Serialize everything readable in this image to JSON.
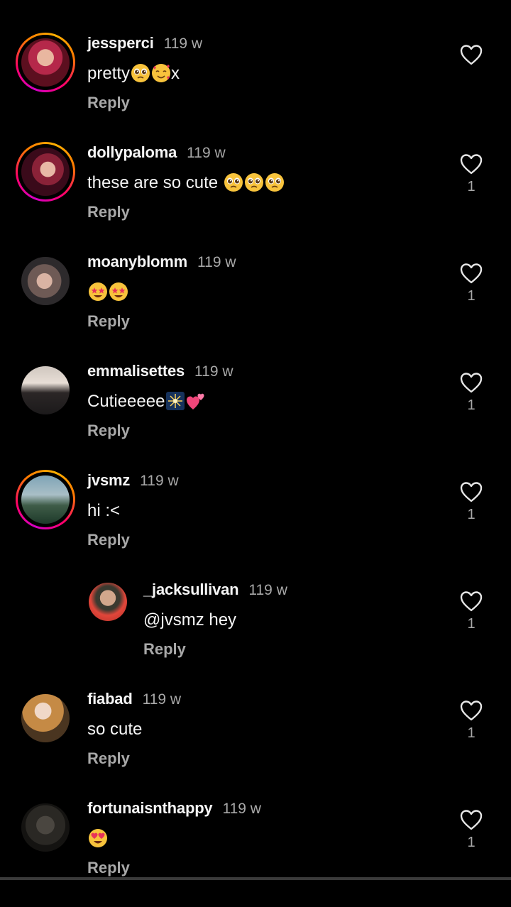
{
  "comments": [
    {
      "username": "jessperci",
      "time": "119 w",
      "text": "pretty",
      "text_suffix": "x",
      "emojis": [
        "pleading-face-emoji",
        "smiling-face-with-hearts-emoji"
      ],
      "reply_label": "Reply",
      "likes": "",
      "has_story_ring": true
    },
    {
      "username": "dollypaloma",
      "time": "119 w",
      "text": "these are so cute ",
      "emojis": [
        "pleading-face-emoji",
        "pleading-face-emoji",
        "pleading-face-emoji"
      ],
      "reply_label": "Reply",
      "likes": "1",
      "has_story_ring": true
    },
    {
      "username": "moanyblomm",
      "time": "119 w",
      "text": "",
      "emojis": [
        "star-struck-emoji",
        "star-struck-emoji"
      ],
      "reply_label": "Reply",
      "likes": "1",
      "has_story_ring": false
    },
    {
      "username": "emmalisettes",
      "time": "119 w",
      "text": "Cutieeeee",
      "emojis": [
        "sparkler-emoji",
        "two-hearts-emoji"
      ],
      "reply_label": "Reply",
      "likes": "1",
      "has_story_ring": false
    },
    {
      "username": "jvsmz",
      "time": "119 w",
      "text": "hi :<",
      "emojis": [],
      "reply_label": "Reply",
      "likes": "1",
      "has_story_ring": true
    },
    {
      "username": "_jacksullivan",
      "time": "119 w",
      "text": "@jvsmz hey",
      "emojis": [],
      "reply_label": "Reply",
      "likes": "1",
      "has_story_ring": false,
      "is_reply": true
    },
    {
      "username": "fiabad",
      "time": "119 w",
      "text": "so cute",
      "emojis": [],
      "reply_label": "Reply",
      "likes": "1",
      "has_story_ring": false
    },
    {
      "username": "fortunaisnthappy",
      "time": "119 w",
      "text": "",
      "emojis": [
        "heart-eyes-emoji"
      ],
      "reply_label": "Reply",
      "likes": "1",
      "has_story_ring": false
    }
  ],
  "colors": {
    "background": "#000000",
    "primary_text": "#f5f5f5",
    "secondary_text": "#a8a8a8",
    "story_ring_start": "#d300c5",
    "story_ring_end": "#ffb100"
  }
}
